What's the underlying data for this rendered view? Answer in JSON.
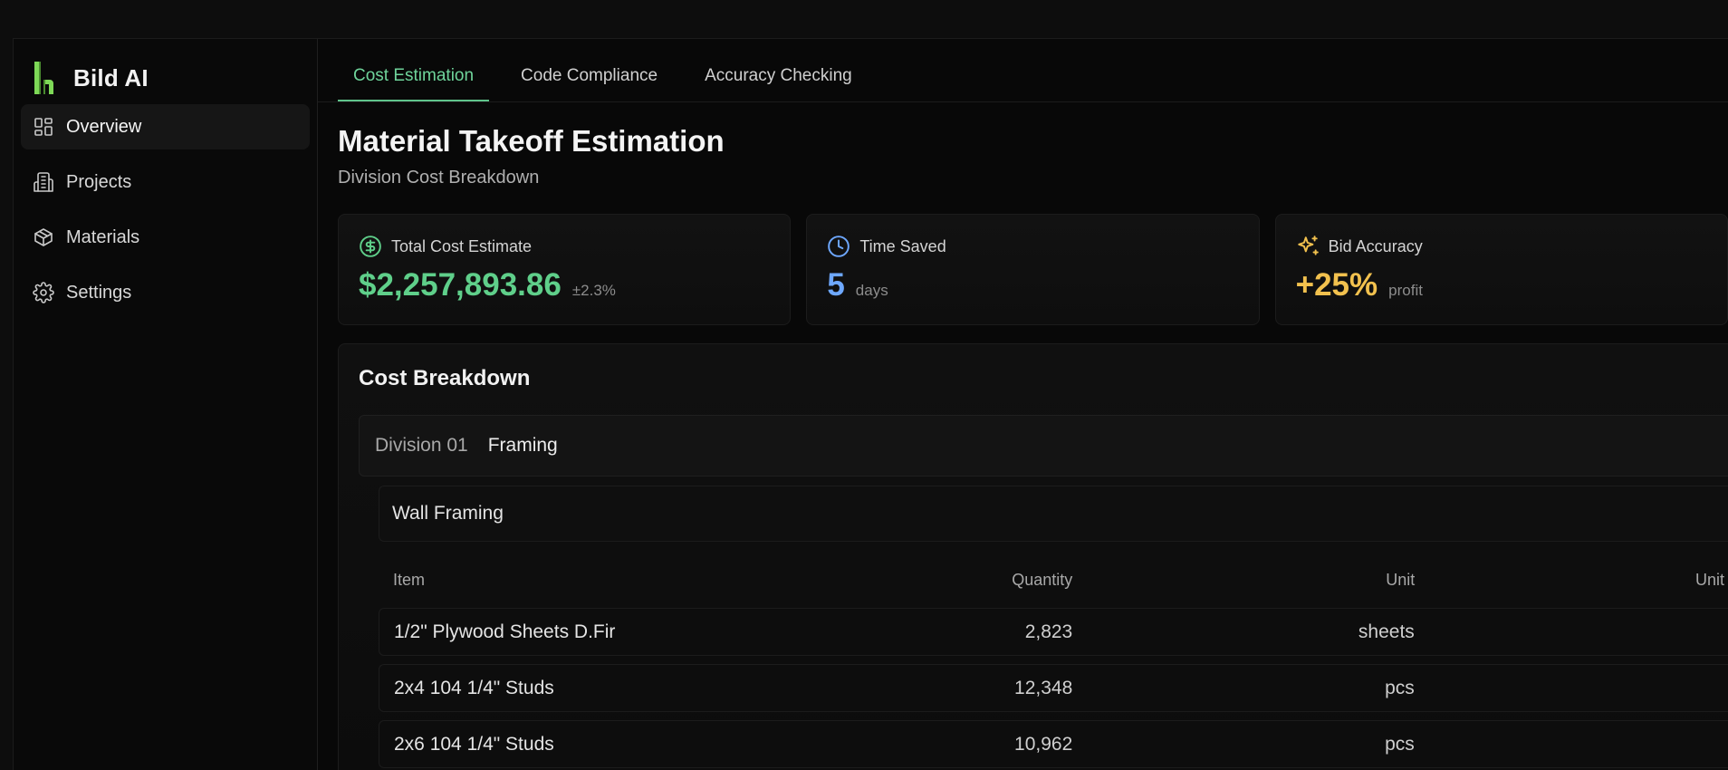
{
  "brand": {
    "name": "Bild AI",
    "accent": "#7ed957"
  },
  "sidebar": {
    "items": [
      {
        "label": "Overview",
        "icon": "dashboard-icon",
        "active": true
      },
      {
        "label": "Projects",
        "icon": "building-icon",
        "active": false
      },
      {
        "label": "Materials",
        "icon": "box-icon",
        "active": false
      },
      {
        "label": "Settings",
        "icon": "gear-icon",
        "active": false
      }
    ]
  },
  "tabs": [
    {
      "label": "Cost Estimation",
      "active": true
    },
    {
      "label": "Code Compliance",
      "active": false
    },
    {
      "label": "Accuracy Checking",
      "active": false
    }
  ],
  "header": {
    "title": "Material Takeoff Estimation",
    "subtitle": "Division Cost Breakdown"
  },
  "cards": [
    {
      "label": "Total Cost Estimate",
      "icon": "dollar-circle-icon",
      "value": "$2,257,893.86",
      "suffix": "±2.3%",
      "color": "#5fcf8a"
    },
    {
      "label": "Time Saved",
      "icon": "clock-icon",
      "value": "5",
      "suffix": "days",
      "color": "#6ea8ff"
    },
    {
      "label": "Bid Accuracy",
      "icon": "sparkles-icon",
      "value": "+25%",
      "suffix": "profit",
      "color": "#f2c14e"
    }
  ],
  "breakdown": {
    "title": "Cost Breakdown",
    "division": {
      "code": "Division 01",
      "name": "Framing"
    },
    "section": "Wall Framing",
    "columns": [
      "Item",
      "Quantity",
      "Unit",
      "Unit Price"
    ],
    "rows": [
      {
        "item": "1/2\" Plywood Sheets D.Fir",
        "quantity": "2,823",
        "unit": "sheets",
        "unit_price": "$"
      },
      {
        "item": "2x4 104 1/4\" Studs",
        "quantity": "12,348",
        "unit": "pcs",
        "unit_price": ""
      },
      {
        "item": "2x6 104 1/4\" Studs",
        "quantity": "10,962",
        "unit": "pcs",
        "unit_price": ""
      }
    ]
  }
}
